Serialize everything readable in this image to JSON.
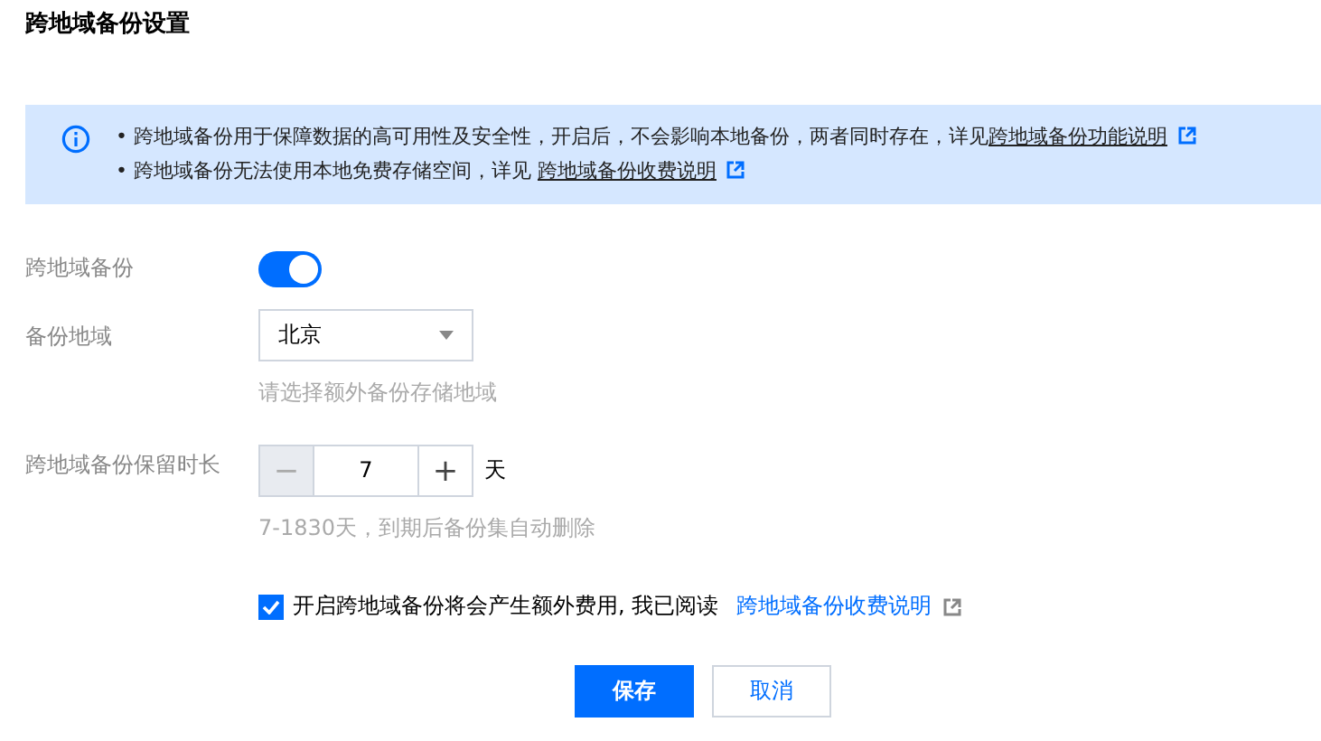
{
  "title": "跨地域备份设置",
  "notice": {
    "lines": [
      {
        "text": "• 跨地域备份用于保障数据的高可用性及安全性，开启后，不会影响本地备份，两者同时存在，详见",
        "link": "跨地域备份功能说明"
      },
      {
        "text": "• 跨地域备份无法使用本地免费存储空间，详见 ",
        "link": "跨地域备份收费说明"
      }
    ]
  },
  "fields": [
    {
      "kind": "switch",
      "label": "跨地域备份",
      "on": true
    },
    {
      "kind": "select",
      "label": "备份地域",
      "value": "北京",
      "hint": "请选择额外备份存储地域"
    },
    {
      "kind": "stepper",
      "label": "跨地域备份保留时长",
      "value": "7",
      "decrement": "−",
      "increment": "+",
      "unit": "天",
      "hint": "7-1830天，到期后备份集自动删除"
    }
  ],
  "agreement": {
    "checked": true,
    "text": "开启跨地域备份将会产生额外费用, 我已阅读",
    "link": "跨地域备份收费说明"
  },
  "buttons": [
    {
      "label": "保存",
      "kind": "primary"
    },
    {
      "label": "取消",
      "kind": "default"
    }
  ]
}
